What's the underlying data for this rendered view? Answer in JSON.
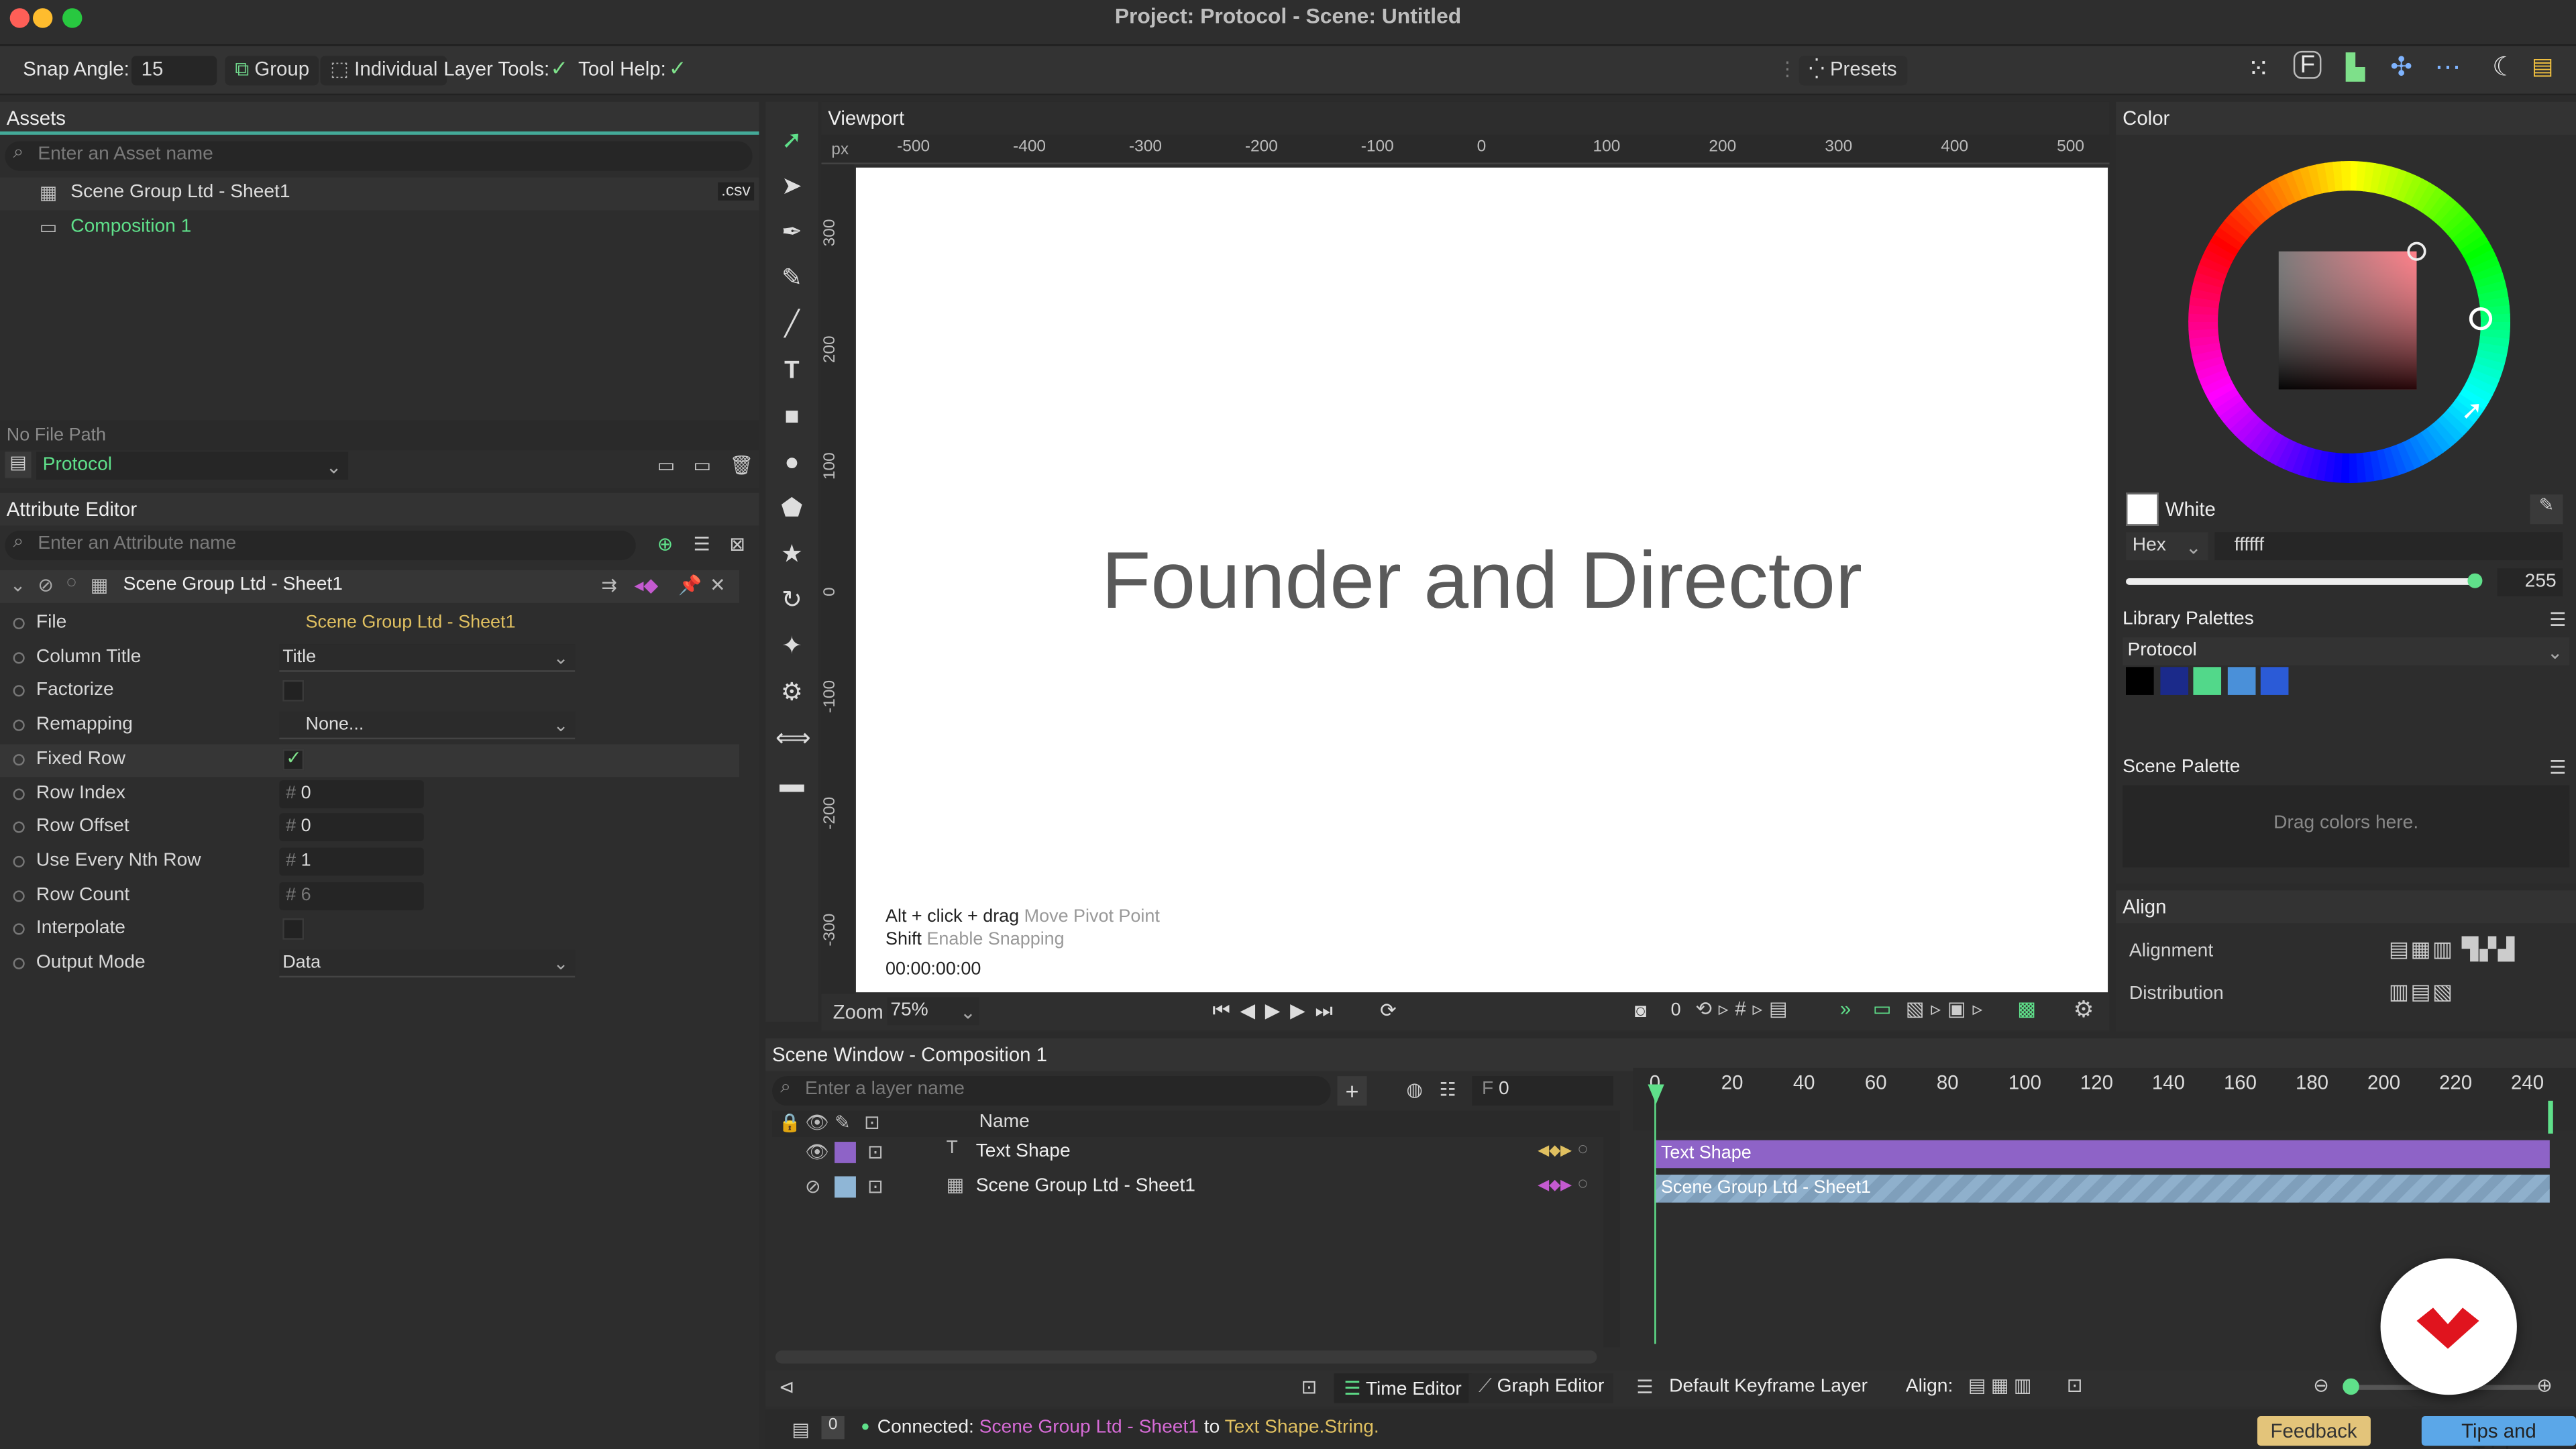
{
  "window": {
    "title": "Project: Protocol - Scene: Untitled"
  },
  "toolbar": {
    "snap_angle_label": "Snap Angle:",
    "snap_angle_value": "15",
    "group_label": "Group",
    "individual_label": "Individual",
    "layer_tools_label": "Layer Tools:",
    "tool_help_label": "Tool Help:",
    "presets_label": "Presets"
  },
  "assets": {
    "title": "Assets",
    "search_placeholder": "Enter an Asset name",
    "items": [
      {
        "label": "Scene Group Ltd - Sheet1",
        "badge": ".csv"
      },
      {
        "label": "Composition 1"
      }
    ],
    "file_path": "No File Path",
    "project": "Protocol"
  },
  "attribute_editor": {
    "title": "Attribute Editor",
    "search_placeholder": "Enter an Attribute name",
    "node_name": "Scene Group Ltd - Sheet1",
    "rows": [
      {
        "label": "File",
        "value": "Scene Group Ltd - Sheet1"
      },
      {
        "label": "Column Title",
        "value": "Title"
      },
      {
        "label": "Factorize",
        "value": ""
      },
      {
        "label": "Remapping",
        "value": "None..."
      },
      {
        "label": "Fixed Row",
        "value": "✓"
      },
      {
        "label": "Row Index",
        "value": "0"
      },
      {
        "label": "Row Offset",
        "value": "0"
      },
      {
        "label": "Use Every Nth Row",
        "value": "1"
      },
      {
        "label": "Row Count",
        "value": "6"
      },
      {
        "label": "Interpolate",
        "value": ""
      },
      {
        "label": "Output Mode",
        "value": "Data"
      }
    ]
  },
  "viewport": {
    "title": "Viewport",
    "unit": "px",
    "h_ticks": [
      "-500",
      "-400",
      "-300",
      "-200",
      "-100",
      "0",
      "100",
      "200",
      "300",
      "400",
      "500"
    ],
    "v_ticks": [
      "300",
      "200",
      "100",
      "0",
      "-100",
      "-200",
      "-300"
    ],
    "canvas_text": "Founder and Director",
    "hint1_key": "Alt + click + drag",
    "hint1_action": "Move Pivot Point",
    "hint2_key": "Shift",
    "hint2_action": "Enable Snapping",
    "timecode": "00:00:00:00",
    "zoom_label": "Zoom",
    "zoom_value": "75%",
    "frame_value": "0"
  },
  "color": {
    "title": "Color",
    "swatch_name": "White",
    "mode": "Hex",
    "hex_value": "ffffff",
    "alpha_value": "255",
    "library_title": "Library Palettes",
    "library_name": "Protocol",
    "palette": [
      "#000000",
      "#1b2a8a",
      "#52d88a",
      "#4a90d9",
      "#2b5bd7"
    ],
    "scene_palette_title": "Scene Palette",
    "scene_palette_hint": "Drag colors here."
  },
  "align": {
    "title": "Align",
    "alignment_label": "Alignment",
    "distribution_label": "Distribution"
  },
  "scene_window": {
    "title": "Scene Window - Composition 1",
    "search_placeholder": "Enter a layer name",
    "frame_label": "F",
    "frame_value": "0",
    "name_header": "Name",
    "layers": [
      {
        "name": "Text Shape",
        "color": "#8e63c7"
      },
      {
        "name": "Scene Group Ltd - Sheet1",
        "color": "#8fb6d6"
      }
    ],
    "timeline_ticks": [
      "0",
      "20",
      "40",
      "60",
      "80",
      "100",
      "120",
      "140",
      "160",
      "180",
      "200",
      "220",
      "240"
    ],
    "time_editor": "Time Editor",
    "graph_editor": "Graph Editor",
    "keyframe_layer": "Default Keyframe Layer",
    "align_label": "Align:"
  },
  "status": {
    "count": "0",
    "prefix": "Connected:",
    "source": "Scene Group Ltd - Sheet1",
    "middle": "to",
    "target": "Text Shape.String."
  },
  "buttons": {
    "feedback": "Feedback",
    "tips": "Tips and Tricks"
  }
}
